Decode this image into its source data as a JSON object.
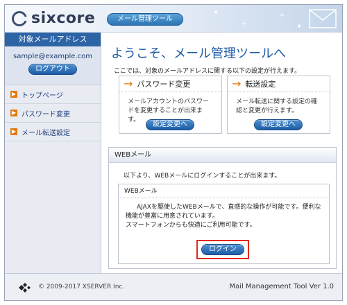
{
  "header": {
    "logo_text": "sixcore",
    "app_name": "メール管理ツール"
  },
  "sidebar": {
    "heading": "対象メールアドレス",
    "email": "sample@example.com",
    "logout_label": "ログアウト",
    "items": [
      {
        "label": "トップページ"
      },
      {
        "label": "パスワード変更"
      },
      {
        "label": "メール転送設定"
      }
    ]
  },
  "main": {
    "title": "ようこそ、メール管理ツールへ",
    "intro": "ここでは、対象のメールアドレスに関する以下の設定が行えます。",
    "cards": [
      {
        "title": "パスワード変更",
        "text": "メールアカウントのパスワードを変更することが出来ます。",
        "button": "設定変更へ"
      },
      {
        "title": "転送設定",
        "text": "メール転送に関する設定の確認と変更が行えます。",
        "button": "設定変更へ"
      }
    ],
    "webmail": {
      "heading": "WEBメール",
      "text": "以下より、WEBメールにログインすることが出来ます。",
      "box_heading": "WEBメール",
      "box_text1": "AJAXを駆使したWEBメールで、直感的な操作が可能です。便利な機能が豊富に用意されています。",
      "box_text2": "スマートフォンからも快適にご利用可能です。",
      "login_label": "ログイン"
    }
  },
  "footer": {
    "copyright": "© 2009-2017 XSERVER Inc.",
    "version": "Mail Management Tool Ver 1.0"
  },
  "colors": {
    "accent": "#2c64a6",
    "arrow": "#e07a10",
    "highlight": "#e0281c"
  },
  "icons": {
    "logo": "sixcore-logo-icon",
    "nav": "arrow-right-icon",
    "mail": "envelope-icon",
    "footer": "diamond-logo-icon"
  }
}
